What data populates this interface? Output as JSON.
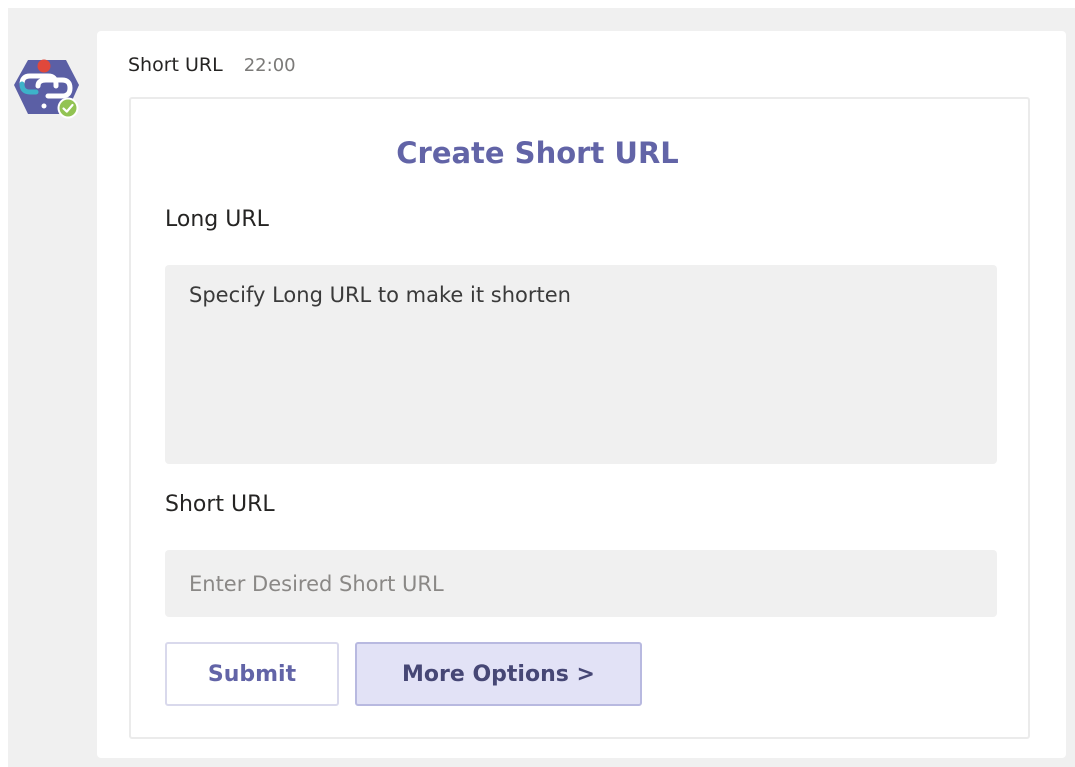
{
  "colors": {
    "accent": "#6264a7",
    "background": "#f0f0f0",
    "avatar_purple": "#5b5fa5",
    "avatar_red": "#e0483b",
    "avatar_teal": "#3db2c9",
    "status_green": "#92c353"
  },
  "message": {
    "sender": "Short URL",
    "timestamp": "22:00",
    "avatar_icon": "link-bot-icon",
    "status_icon": "check-circle-icon"
  },
  "card": {
    "title": "Create Short URL",
    "long_url": {
      "label": "Long URL",
      "placeholder": "Specify Long URL to make it shorten",
      "value": ""
    },
    "short_url": {
      "label": "Short URL",
      "placeholder": "Enter Desired Short URL",
      "value": ""
    },
    "actions": {
      "submit_label": "Submit",
      "more_options_label": "More Options >"
    }
  }
}
